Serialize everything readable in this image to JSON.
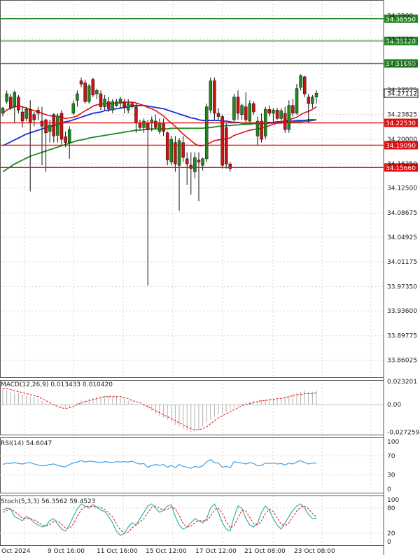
{
  "chart_data": {
    "type": "candlestick",
    "main": {
      "ylim": [
        33.835,
        34.41
      ],
      "y_ticks": [
        "34.3900",
        "34.3538",
        "34.31500",
        "34.27575",
        "34.23825",
        "34.20000",
        "34.16250",
        "34.12500",
        "34.08675",
        "34.04925",
        "34.01175",
        "33.97350",
        "33.93600",
        "33.89775",
        "33.86025"
      ],
      "x_labels": [
        "Oct 2024",
        "9 Oct 16:00",
        "11 Oct 16:00",
        "15 Oct 12:00",
        "17 Oct 12:00",
        "21 Oct 08:00",
        "23 Oct 08:00"
      ],
      "current_price": "34.27112",
      "price_lines": [
        {
          "label": "34.38550",
          "value": 34.3855,
          "color": "#1e8a1e"
        },
        {
          "label": "34.35120",
          "value": 34.3512,
          "color": "#1e8a1e"
        },
        {
          "label": "34.31680",
          "value": 34.3168,
          "color": "#1e8a1e"
        },
        {
          "label": "34.22530",
          "value": 34.2253,
          "color": "#e01010"
        },
        {
          "label": "34.19090",
          "value": 34.1909,
          "color": "#e01010"
        },
        {
          "label": "34.15660",
          "value": 34.1566,
          "color": "#e01010"
        }
      ],
      "candles": [
        [
          34.24,
          34.25,
          34.235,
          34.248
        ],
        [
          34.258,
          34.275,
          34.255,
          34.27
        ],
        [
          34.265,
          34.27,
          34.245,
          34.248
        ],
        [
          34.25,
          34.275,
          34.225,
          34.272
        ],
        [
          34.265,
          34.268,
          34.24,
          34.245
        ],
        [
          34.242,
          34.25,
          34.218,
          34.228
        ],
        [
          34.232,
          34.25,
          34.228,
          34.246
        ],
        [
          34.246,
          34.26,
          34.12,
          34.225
        ],
        [
          34.238,
          34.242,
          34.22,
          34.23
        ],
        [
          34.245,
          34.25,
          34.23,
          34.24
        ],
        [
          34.228,
          34.25,
          34.16,
          34.22
        ],
        [
          34.23,
          34.232,
          34.15,
          34.21
        ],
        [
          34.212,
          34.23,
          34.195,
          34.222
        ],
        [
          34.238,
          34.24,
          34.195,
          34.205
        ],
        [
          34.206,
          34.24,
          34.195,
          34.236
        ],
        [
          34.24,
          34.245,
          34.19,
          34.2
        ],
        [
          34.204,
          34.212,
          34.188,
          34.195
        ],
        [
          34.195,
          34.22,
          34.17,
          34.215
        ],
        [
          34.24,
          34.26,
          34.238,
          34.255
        ],
        [
          34.26,
          34.275,
          34.25,
          34.27
        ],
        [
          34.29,
          34.295,
          34.28,
          34.285
        ],
        [
          34.287,
          34.292,
          34.255,
          34.258
        ],
        [
          34.258,
          34.285,
          34.255,
          34.282
        ],
        [
          34.292,
          34.295,
          34.265,
          34.268
        ],
        [
          34.27,
          34.278,
          34.262,
          34.275
        ],
        [
          34.27,
          34.275,
          34.245,
          34.25
        ],
        [
          34.25,
          34.268,
          34.245,
          34.262
        ],
        [
          34.258,
          34.265,
          34.242,
          34.247
        ],
        [
          34.245,
          34.262,
          34.24,
          34.258
        ],
        [
          34.252,
          34.262,
          34.25,
          34.258
        ],
        [
          34.256,
          34.265,
          34.248,
          34.262
        ],
        [
          34.258,
          34.262,
          34.24,
          34.25
        ],
        [
          34.245,
          34.262,
          34.24,
          34.255
        ],
        [
          34.255,
          34.258,
          34.248,
          34.25
        ],
        [
          34.25,
          34.255,
          34.21,
          34.225
        ],
        [
          34.225,
          34.23,
          34.215,
          34.218
        ],
        [
          34.218,
          34.232,
          34.21,
          34.228
        ],
        [
          34.225,
          34.23,
          33.975,
          34.215
        ],
        [
          34.225,
          34.235,
          34.212,
          34.23
        ],
        [
          34.228,
          34.238,
          34.215,
          34.218
        ],
        [
          34.212,
          34.232,
          34.208,
          34.225
        ],
        [
          34.225,
          34.232,
          34.205,
          34.212
        ],
        [
          34.21,
          34.212,
          34.16,
          34.168
        ],
        [
          34.165,
          34.205,
          34.16,
          34.2
        ],
        [
          34.195,
          34.205,
          34.15,
          34.162
        ],
        [
          34.16,
          34.202,
          34.09,
          34.198
        ],
        [
          34.195,
          34.205,
          34.165,
          34.172
        ],
        [
          34.17,
          34.18,
          34.13,
          34.162
        ],
        [
          34.16,
          34.18,
          34.115,
          34.155
        ],
        [
          34.15,
          34.18,
          34.14,
          34.172
        ],
        [
          34.168,
          34.18,
          34.105,
          34.165
        ],
        [
          34.16,
          34.172,
          34.152,
          34.17
        ],
        [
          34.17,
          34.255,
          34.165,
          34.25
        ],
        [
          34.245,
          34.295,
          34.24,
          34.29
        ],
        [
          34.29,
          34.295,
          34.23,
          34.24
        ],
        [
          34.24,
          34.248,
          34.23,
          34.235
        ],
        [
          34.235,
          34.238,
          34.155,
          34.16
        ],
        [
          34.218,
          34.225,
          34.155,
          34.162
        ],
        [
          34.162,
          34.165,
          34.15,
          34.155
        ],
        [
          34.23,
          34.27,
          34.225,
          34.265
        ],
        [
          34.265,
          34.275,
          34.23,
          34.24
        ],
        [
          34.238,
          34.255,
          34.23,
          34.252
        ],
        [
          34.25,
          34.272,
          34.225,
          34.23
        ],
        [
          34.228,
          34.26,
          34.225,
          34.255
        ],
        [
          34.255,
          34.258,
          34.238,
          34.242
        ],
        [
          34.205,
          34.235,
          34.19,
          34.228
        ],
        [
          34.228,
          34.24,
          34.195,
          34.2
        ],
        [
          34.205,
          34.25,
          34.2,
          34.246
        ],
        [
          34.246,
          34.252,
          34.235,
          34.24
        ],
        [
          34.24,
          34.248,
          34.225,
          34.245
        ],
        [
          34.245,
          34.248,
          34.23,
          34.232
        ],
        [
          34.232,
          34.248,
          34.228,
          34.244
        ],
        [
          34.24,
          34.25,
          34.21,
          34.215
        ],
        [
          34.215,
          34.26,
          34.21,
          34.252
        ],
        [
          34.252,
          34.262,
          34.235,
          34.24
        ],
        [
          34.24,
          34.285,
          34.238,
          34.278
        ],
        [
          34.28,
          34.3,
          34.275,
          34.298
        ],
        [
          34.296,
          34.298,
          34.265,
          34.27
        ],
        [
          34.265,
          34.27,
          34.225,
          34.255
        ],
        [
          34.255,
          34.268,
          34.248,
          34.265
        ],
        [
          34.265,
          34.275,
          34.255,
          34.271
        ]
      ],
      "ma_red": [
        34.24,
        34.245,
        34.248,
        34.25,
        34.251,
        34.25,
        34.248,
        34.246,
        34.244,
        34.242,
        34.24,
        34.238,
        34.236,
        34.236,
        34.235,
        34.234,
        34.232,
        34.233,
        34.234,
        34.236,
        34.24,
        34.244,
        34.247,
        34.251,
        34.253,
        34.254,
        34.255,
        34.255,
        34.255,
        34.256,
        34.256,
        34.257,
        34.257,
        34.257,
        34.256,
        34.254,
        34.252,
        34.249,
        34.247,
        34.244,
        34.24,
        34.236,
        34.23,
        34.225,
        34.22,
        34.214,
        34.208,
        34.203,
        34.198,
        34.193,
        34.19,
        34.19,
        34.192,
        34.195,
        34.198,
        34.199,
        34.2,
        34.201,
        34.202,
        34.206,
        34.208,
        34.21,
        34.212,
        34.214,
        34.215,
        34.216,
        34.217,
        34.219,
        34.221,
        34.223,
        34.225,
        34.227,
        34.228,
        34.23,
        34.232,
        34.234,
        34.238,
        34.241,
        34.243,
        34.246,
        34.25
      ],
      "ma_blue": [
        34.19,
        34.193,
        34.196,
        34.199,
        34.202,
        34.205,
        34.208,
        34.21,
        34.212,
        34.214,
        34.216,
        34.218,
        34.22,
        34.221,
        34.223,
        34.225,
        34.227,
        34.228,
        34.23,
        34.232,
        34.234,
        34.236,
        34.238,
        34.24,
        34.241,
        34.242,
        34.244,
        34.245,
        34.246,
        34.247,
        34.248,
        34.249,
        34.25,
        34.251,
        34.252,
        34.252,
        34.252,
        34.251,
        34.25,
        34.249,
        34.248,
        34.247,
        34.245,
        34.243,
        34.241,
        34.239,
        34.237,
        34.235,
        34.233,
        34.232,
        34.23,
        34.229,
        34.229,
        34.229,
        34.229,
        34.229,
        34.228,
        34.228,
        34.227,
        34.226,
        34.226,
        34.225,
        34.225,
        34.225,
        34.225,
        34.225,
        34.225,
        34.226,
        34.226,
        34.226,
        34.227,
        34.227,
        34.228,
        34.228,
        34.228,
        34.229,
        34.229,
        34.229,
        34.23,
        34.23,
        34.23
      ],
      "ma_green": [
        34.15,
        34.154,
        34.158,
        34.162,
        34.165,
        34.168,
        34.171,
        34.174,
        34.176,
        34.178,
        34.18,
        34.182,
        34.184,
        34.186,
        34.188,
        34.19,
        34.192,
        34.194,
        34.196,
        34.198,
        34.199,
        34.2,
        34.202,
        34.203,
        34.204,
        34.205,
        34.206,
        34.207,
        34.208,
        34.209,
        34.21,
        34.211,
        34.212,
        34.213,
        34.214,
        34.214,
        34.215,
        34.215,
        34.216,
        34.216,
        34.216,
        34.216,
        34.216,
        34.217,
        34.217,
        34.217,
        34.217,
        34.217,
        34.217,
        34.217,
        34.217,
        34.217,
        34.218,
        34.218,
        34.219,
        34.22,
        34.22,
        34.221,
        34.221,
        34.222,
        34.222,
        34.223,
        34.223,
        34.223,
        34.224,
        34.224,
        34.224,
        34.224,
        34.225,
        34.225,
        34.225,
        34.225,
        34.226,
        34.226,
        34.226,
        34.227,
        34.227,
        34.228,
        34.228,
        34.229,
        34.23
      ]
    },
    "macd": {
      "label": "MACD(12,26,9) 0.013433 0.010420",
      "y_ticks": [
        "0.023201",
        "0.00",
        "-0.027259"
      ],
      "ylim": [
        -0.0305,
        0.0245
      ],
      "hist": [
        0.016,
        0.015,
        0.013,
        0.012,
        0.012,
        0.01,
        0.009,
        0.008,
        0.008,
        0.006,
        0.004,
        0.002,
        0.001,
        0.0,
        -0.001,
        -0.002,
        -0.003,
        -0.002,
        -0.001,
        0.002,
        0.004,
        0.005,
        0.006,
        0.007,
        0.008,
        0.008,
        0.009,
        0.009,
        0.008,
        0.008,
        0.007,
        0.006,
        0.004,
        0.002,
        0.001,
        0.0,
        -0.002,
        -0.004,
        -0.006,
        -0.009,
        -0.011,
        -0.013,
        -0.015,
        -0.017,
        -0.02,
        -0.022,
        -0.024,
        -0.026,
        -0.027,
        -0.027,
        -0.025,
        -0.022,
        -0.018,
        -0.015,
        -0.012,
        -0.01,
        -0.009,
        -0.007,
        -0.005,
        -0.003,
        -0.001,
        0.001,
        0.002,
        0.003,
        0.004,
        0.004,
        0.005,
        0.005,
        0.006,
        0.006,
        0.006,
        0.007,
        0.008,
        0.009,
        0.011,
        0.012,
        0.013,
        0.014,
        0.013,
        0.013,
        0.014
      ],
      "signal": [
        0.016,
        0.016,
        0.015,
        0.014,
        0.013,
        0.012,
        0.011,
        0.01,
        0.009,
        0.008,
        0.006,
        0.004,
        0.002,
        0.0,
        -0.002,
        -0.003,
        -0.004,
        -0.003,
        -0.002,
        0.0,
        0.002,
        0.003,
        0.004,
        0.005,
        0.006,
        0.007,
        0.008,
        0.008,
        0.008,
        0.008,
        0.008,
        0.007,
        0.006,
        0.004,
        0.003,
        0.002,
        0.0,
        -0.002,
        -0.004,
        -0.006,
        -0.008,
        -0.01,
        -0.012,
        -0.014,
        -0.016,
        -0.018,
        -0.02,
        -0.022,
        -0.024,
        -0.025,
        -0.025,
        -0.024,
        -0.022,
        -0.019,
        -0.016,
        -0.013,
        -0.011,
        -0.009,
        -0.007,
        -0.005,
        -0.003,
        -0.001,
        0.0,
        0.001,
        0.002,
        0.003,
        0.004,
        0.004,
        0.005,
        0.005,
        0.006,
        0.006,
        0.007,
        0.008,
        0.009,
        0.01,
        0.01,
        0.011,
        0.011,
        0.011,
        0.012
      ]
    },
    "rsi": {
      "label": "RSI(14) 54.6047",
      "y_ticks": [
        "100",
        "70",
        "30",
        "0"
      ],
      "values": [
        52,
        55,
        54,
        56,
        54,
        53,
        55,
        56,
        53,
        51,
        49,
        50,
        52,
        53,
        50,
        48,
        47,
        52,
        55,
        57,
        60,
        57,
        59,
        58,
        57,
        56,
        58,
        57,
        56,
        58,
        57,
        58,
        57,
        59,
        55,
        53,
        54,
        46,
        50,
        52,
        50,
        52,
        46,
        50,
        45,
        52,
        48,
        46,
        44,
        48,
        46,
        49,
        58,
        62,
        56,
        55,
        46,
        48,
        45,
        58,
        56,
        55,
        53,
        56,
        54,
        49,
        50,
        55,
        54,
        55,
        53,
        54,
        51,
        55,
        53,
        57,
        60,
        56,
        53,
        55,
        55
      ]
    },
    "stoch": {
      "label": "Stoch(5,3,3) 56.3562 59.4523",
      "y_ticks": [
        "100",
        "80",
        "20",
        "0"
      ],
      "k": [
        75,
        80,
        78,
        60,
        55,
        50,
        60,
        55,
        45,
        40,
        35,
        38,
        50,
        55,
        42,
        30,
        25,
        40,
        60,
        78,
        90,
        85,
        80,
        88,
        82,
        75,
        72,
        60,
        45,
        25,
        15,
        20,
        35,
        45,
        40,
        55,
        70,
        85,
        90,
        80,
        70,
        75,
        85,
        88,
        60,
        40,
        30,
        35,
        45,
        55,
        50,
        45,
        55,
        80,
        90,
        70,
        45,
        30,
        25,
        60,
        85,
        80,
        55,
        40,
        35,
        45,
        70,
        85,
        75,
        55,
        40,
        30,
        45,
        60,
        75,
        85,
        90,
        80,
        65,
        55,
        56
      ],
      "d": [
        70,
        74,
        78,
        72,
        64,
        56,
        55,
        55,
        52,
        46,
        40,
        38,
        41,
        48,
        49,
        42,
        32,
        32,
        42,
        60,
        76,
        84,
        85,
        84,
        83,
        81,
        76,
        69,
        59,
        43,
        28,
        20,
        23,
        33,
        40,
        47,
        55,
        70,
        82,
        85,
        80,
        75,
        77,
        83,
        78,
        63,
        43,
        35,
        37,
        45,
        50,
        50,
        50,
        60,
        75,
        80,
        68,
        48,
        33,
        38,
        57,
        75,
        73,
        58,
        43,
        40,
        50,
        67,
        77,
        72,
        57,
        42,
        38,
        45,
        60,
        73,
        83,
        85,
        78,
        67,
        59
      ]
    }
  }
}
